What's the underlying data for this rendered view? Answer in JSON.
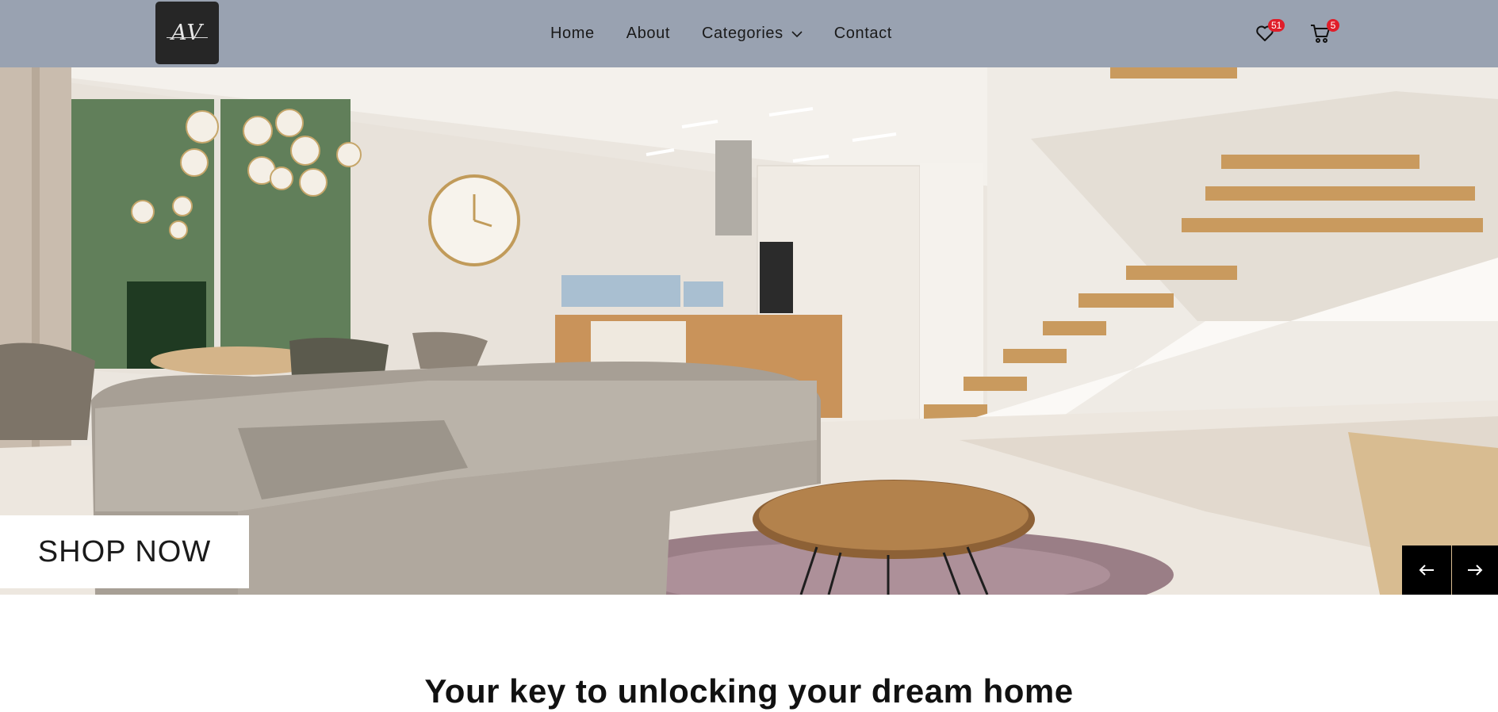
{
  "brand": {
    "logo_text": "AV"
  },
  "nav": {
    "home": "Home",
    "about": "About",
    "categories": "Categories",
    "contact": "Contact"
  },
  "header_icons": {
    "wishlist_icon": "heart-icon",
    "wishlist_count": "51",
    "cart_icon": "cart-icon",
    "cart_count": "5"
  },
  "hero": {
    "cta_label": "SHOP NOW",
    "prev_icon": "arrow-left-icon",
    "next_icon": "arrow-right-icon"
  },
  "section": {
    "heading": "Your key to unlocking your dream home"
  },
  "colors": {
    "header_bg": "#99a2b1",
    "logo_bg": "#262626",
    "badge": "#e01e2a",
    "arrow_bg": "#000000"
  }
}
